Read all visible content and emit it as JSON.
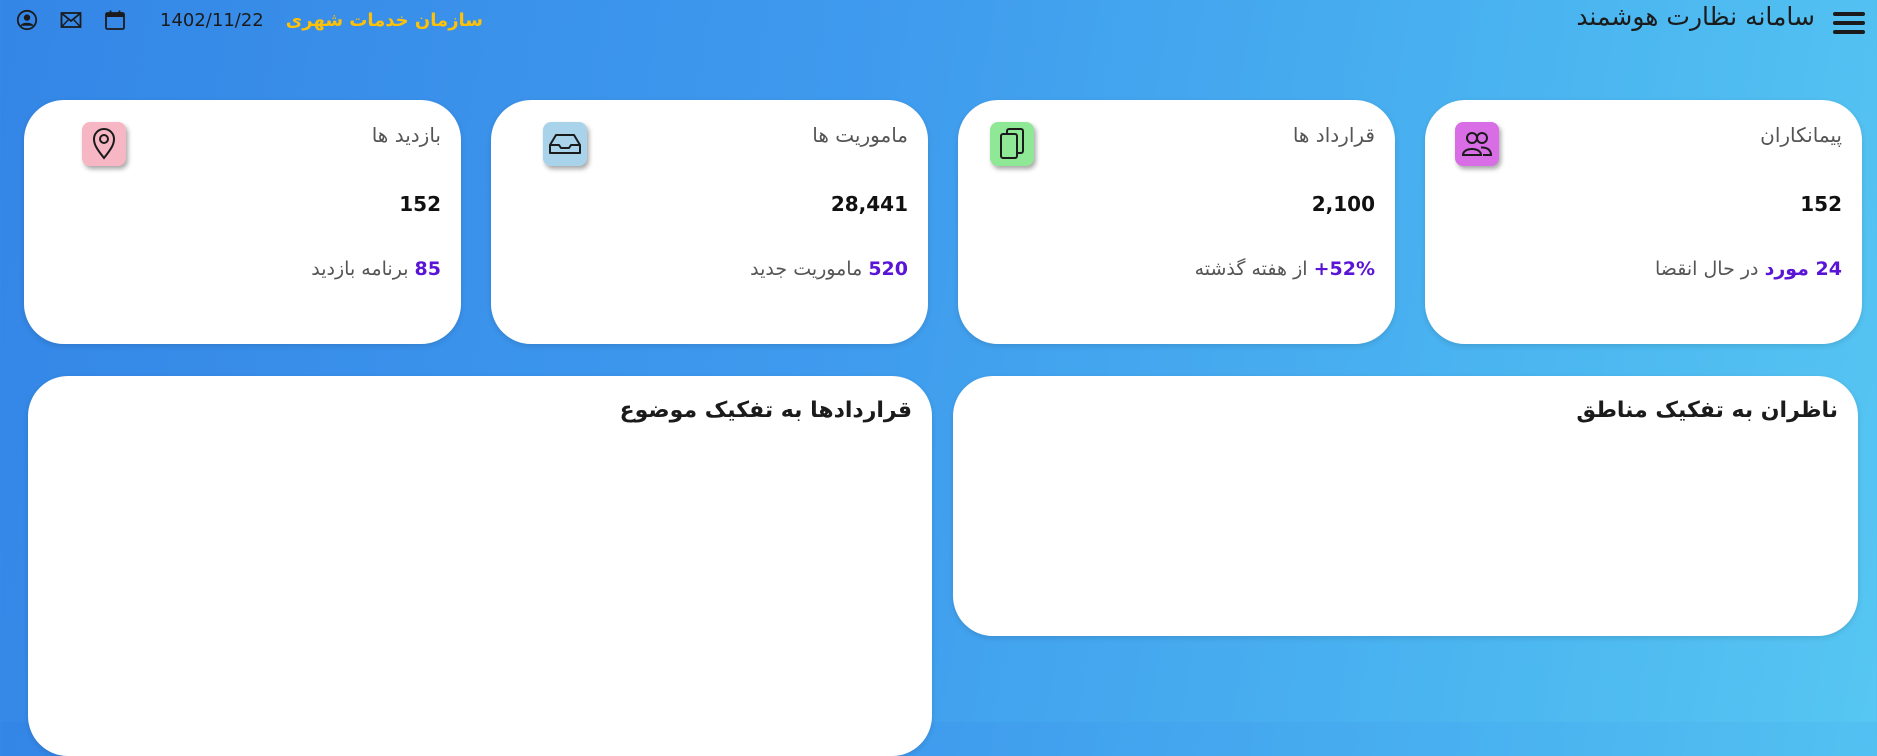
{
  "header": {
    "app_title": "سامانه نظارت هوشمند",
    "org_name": "سازمان خدمات شهری",
    "date": "1402/11/22",
    "icons": {
      "menu": "hamburger-menu-icon",
      "calendar": "calendar-icon",
      "mail": "mail-icon",
      "user": "user-circle-icon"
    }
  },
  "cards": [
    {
      "title": "پیمانکاران",
      "value": "152",
      "highlight": "24 مورد",
      "foot_text": "در حال انقضا",
      "icon": "users-icon",
      "icon_color": "#d86de6"
    },
    {
      "title": "قرارداد ها",
      "value": "2,100",
      "highlight": "+52%",
      "foot_text": "از هفته گذشته",
      "icon": "documents-icon",
      "icon_color": "#8ee895"
    },
    {
      "title": "ماموریت ها",
      "value": "28,441",
      "highlight": "520",
      "foot_text": "ماموریت جدید",
      "icon": "inbox-icon",
      "icon_color": "#a9d3ea"
    },
    {
      "title": "بازدید ها",
      "value": "152",
      "highlight": "85",
      "foot_text": "برنامه بازدید",
      "icon": "map-pin-icon",
      "icon_color": "#f7b6c3"
    }
  ],
  "panels": {
    "inspectors_by_region": {
      "title": "ناظران به تفکیک مناطق"
    },
    "contracts_by_subject": {
      "title": "قراردادها به تفکیک موضوع"
    }
  },
  "colors": {
    "accent_highlight": "#5a14d6",
    "org_name": "#ffc107",
    "bg_start": "#3486e6",
    "bg_end": "#56c6f2"
  }
}
